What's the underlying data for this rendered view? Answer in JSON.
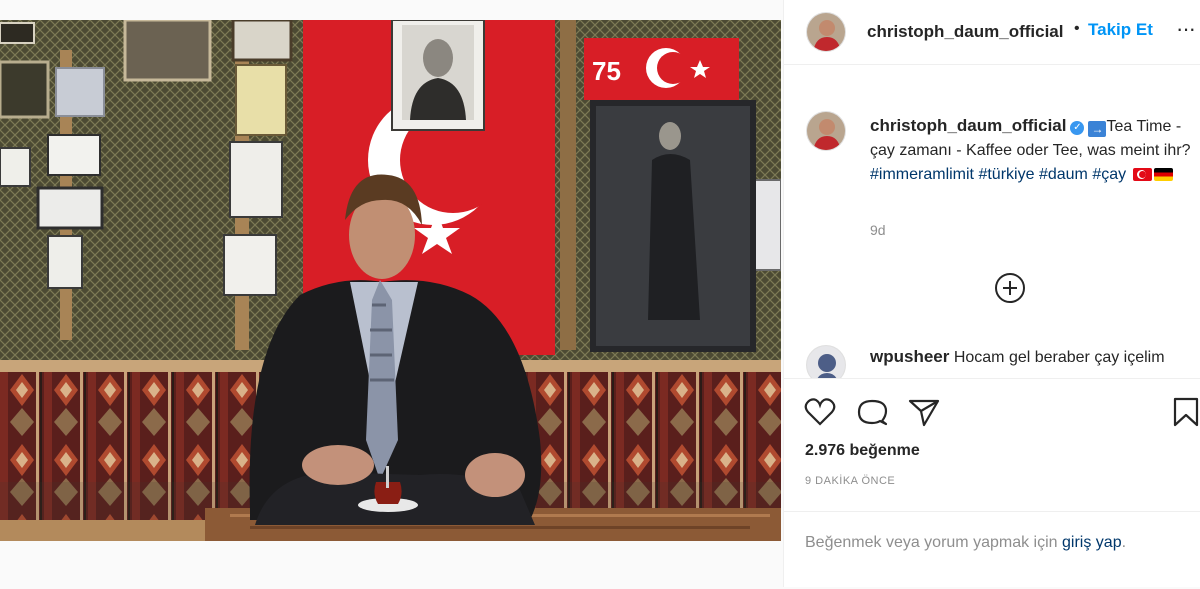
{
  "post": {
    "username": "christoph_daum_official",
    "follow_label": "Takip Et",
    "more_label": "···"
  },
  "caption": {
    "username": "christoph_daum_official",
    "text_before_arrow": "",
    "text_after_arrow": "Tea Time",
    "line2": "- çay zamanı - Kaffee oder Tee, was meint ihr?",
    "hashtags": [
      "#immeramlimit",
      "#türkiye",
      "#daum",
      "#çay"
    ],
    "time": "9d"
  },
  "comment": {
    "username": "wpusheer",
    "text": "Hocam gel beraber çay içelim"
  },
  "photo_text": {
    "anniversary": "75"
  },
  "actions": {
    "likes": "2.976 beğenme",
    "post_time": "9 DAKİKA ÖNCE",
    "login_prefix": "Beğenmek veya yorum yapmak için",
    "login_link": "giriş yap",
    "login_suffix": "."
  },
  "colors": {
    "accent": "#0095f6",
    "link": "#00376b",
    "muted": "#8e8e8e",
    "flag_red": "#e30a17"
  },
  "icons": [
    "heart-icon",
    "comment-icon",
    "share-icon",
    "bookmark-icon",
    "plus-circle-icon",
    "verified-badge-icon"
  ]
}
